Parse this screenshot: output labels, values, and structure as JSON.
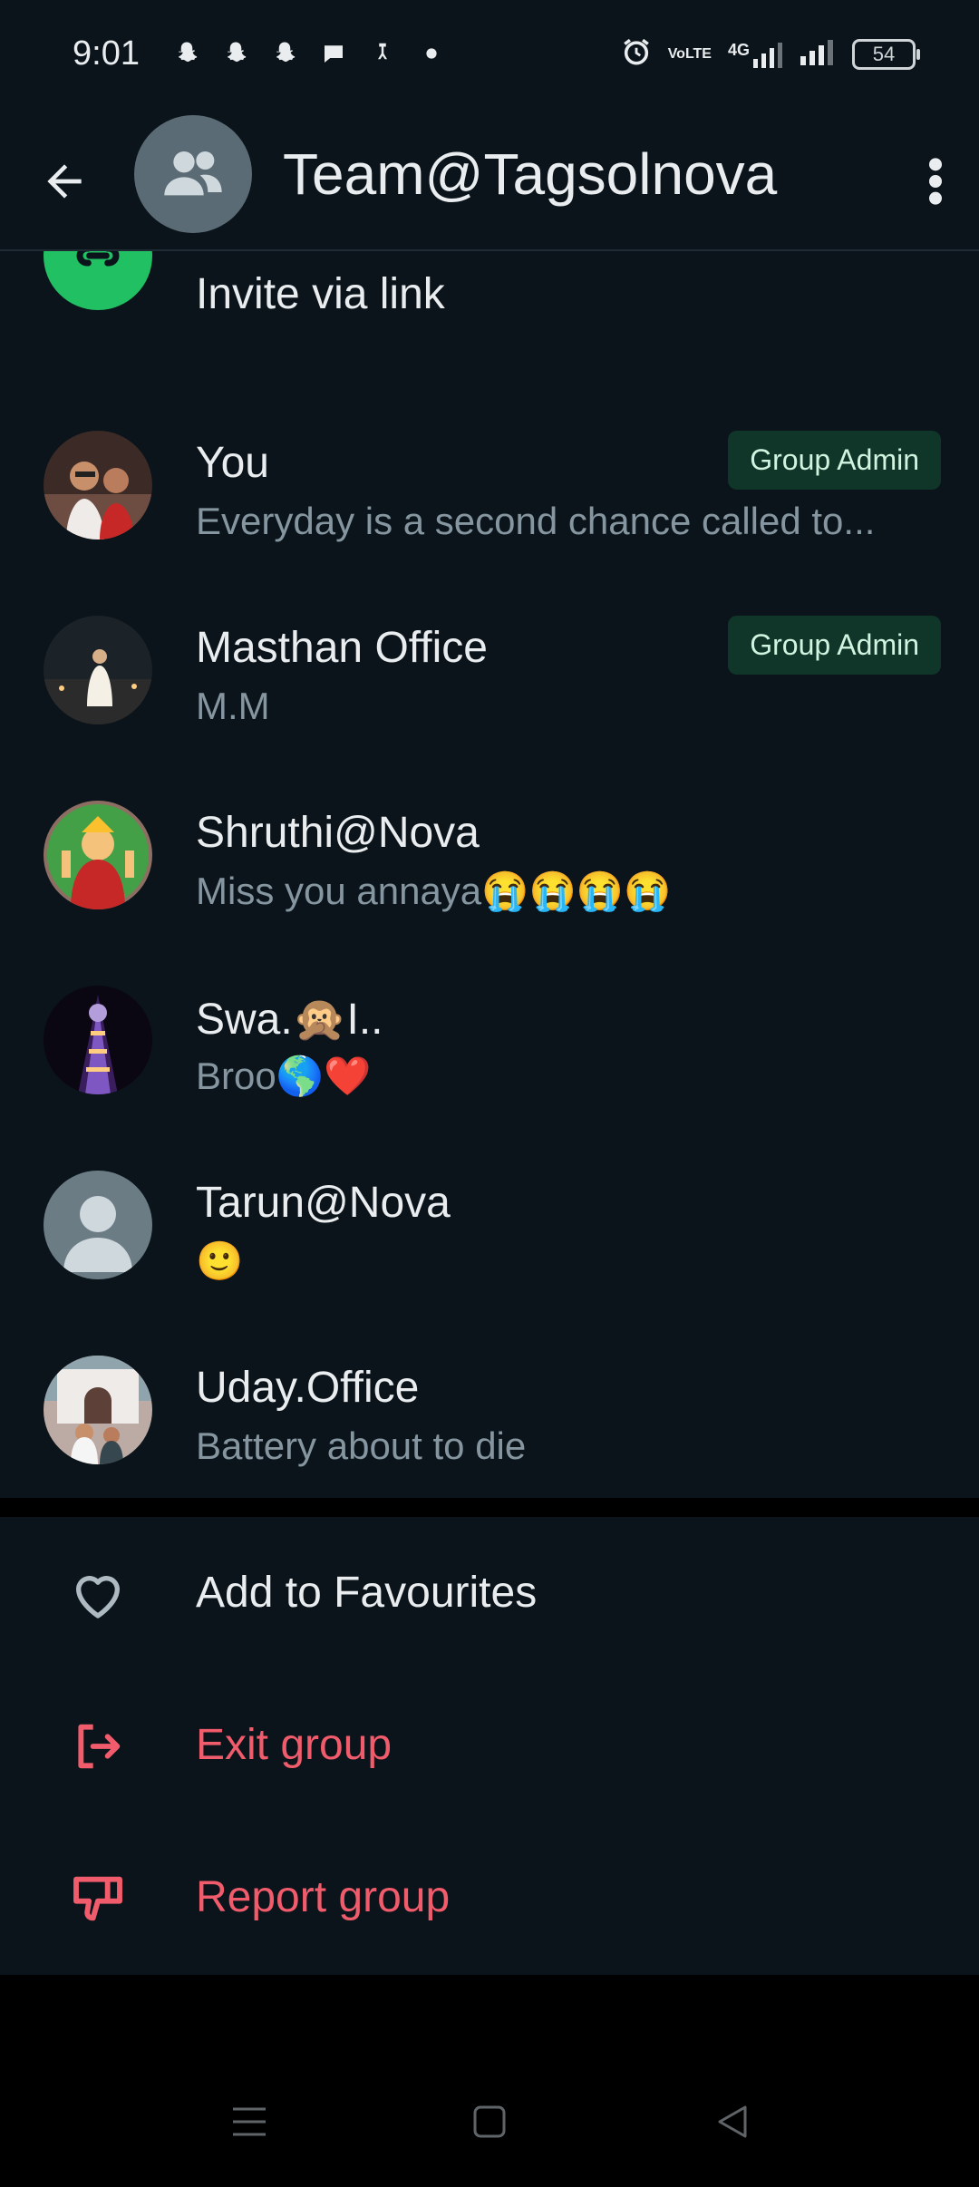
{
  "status_bar": {
    "time": "9:01",
    "battery": "54",
    "network": "4G",
    "volte": "VoLTE"
  },
  "header": {
    "title": "Team@Tagsolnova",
    "back_icon": "arrow-left-icon",
    "more_icon": "more-vert-icon"
  },
  "invite": {
    "label": "Invite via link",
    "color": "#21c063"
  },
  "members": [
    {
      "name": "You",
      "about": "Everyday is a second chance called to...",
      "badge": "Group Admin"
    },
    {
      "name": "Masthan Office",
      "about": "M.M",
      "badge": "Group Admin"
    },
    {
      "name": "Shruthi@Nova",
      "about": "Miss you annaya😭😭😭😭",
      "badge": ""
    },
    {
      "name": "Swa.🙊I..",
      "about": "Broo🌎❤️",
      "badge": ""
    },
    {
      "name": "Tarun@Nova",
      "about": "🙂",
      "badge": ""
    },
    {
      "name": "Uday.Office",
      "about": "Battery about to die",
      "badge": ""
    }
  ],
  "actions": {
    "favourites": "Add to Favourites",
    "exit": "Exit group",
    "report": "Report group"
  },
  "colors": {
    "background": "#0b141a",
    "danger": "#f15c6d",
    "badge_bg": "#103529",
    "badge_text": "#d1f4e0",
    "muted": "#8696a0"
  }
}
